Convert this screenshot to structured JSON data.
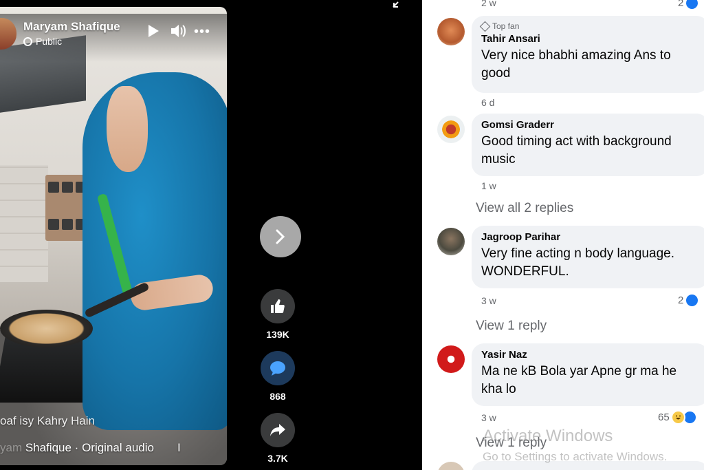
{
  "video": {
    "page_name": "Maryam Shafique",
    "privacy": "Public",
    "caption": "oaf isy Kahry Hain",
    "audio_faded": "yam",
    "audio_text": " Shafique · Original audio",
    "audio_trail": "I"
  },
  "actions": {
    "likes": "139K",
    "comments": "868",
    "shares": "3.7K"
  },
  "comments": {
    "top_time": "2 w",
    "top_reaction_count": "2",
    "items": [
      {
        "badge": "Top fan",
        "name": "Tahir Ansari",
        "text": "Very nice bhabhi amazing Ans to good",
        "time": "6 d"
      },
      {
        "name": "Gomsi Graderr",
        "text": "Good timing act with background music",
        "time": "1 w",
        "view_replies": "View all 2 replies"
      },
      {
        "name": "Jagroop Parihar",
        "text": "Very fine acting n body language. WONDERFUL.",
        "time": "3 w",
        "reaction_count": "2",
        "view_replies": "View 1 reply"
      },
      {
        "name": "Yasir Naz",
        "text": "Ma ne kB Bola yar Apne gr ma he kha lo",
        "time": "3 w",
        "reaction_count": "65",
        "view_replies": "View 1 reply"
      }
    ]
  },
  "watermark": {
    "line1": "Activate Windows",
    "line2": "Go to Settings to activate Windows."
  },
  "colors": {
    "accent": "#1877f2",
    "bubble": "#f0f2f5",
    "meta_text": "#65676b",
    "shawl": "#1674a8"
  }
}
